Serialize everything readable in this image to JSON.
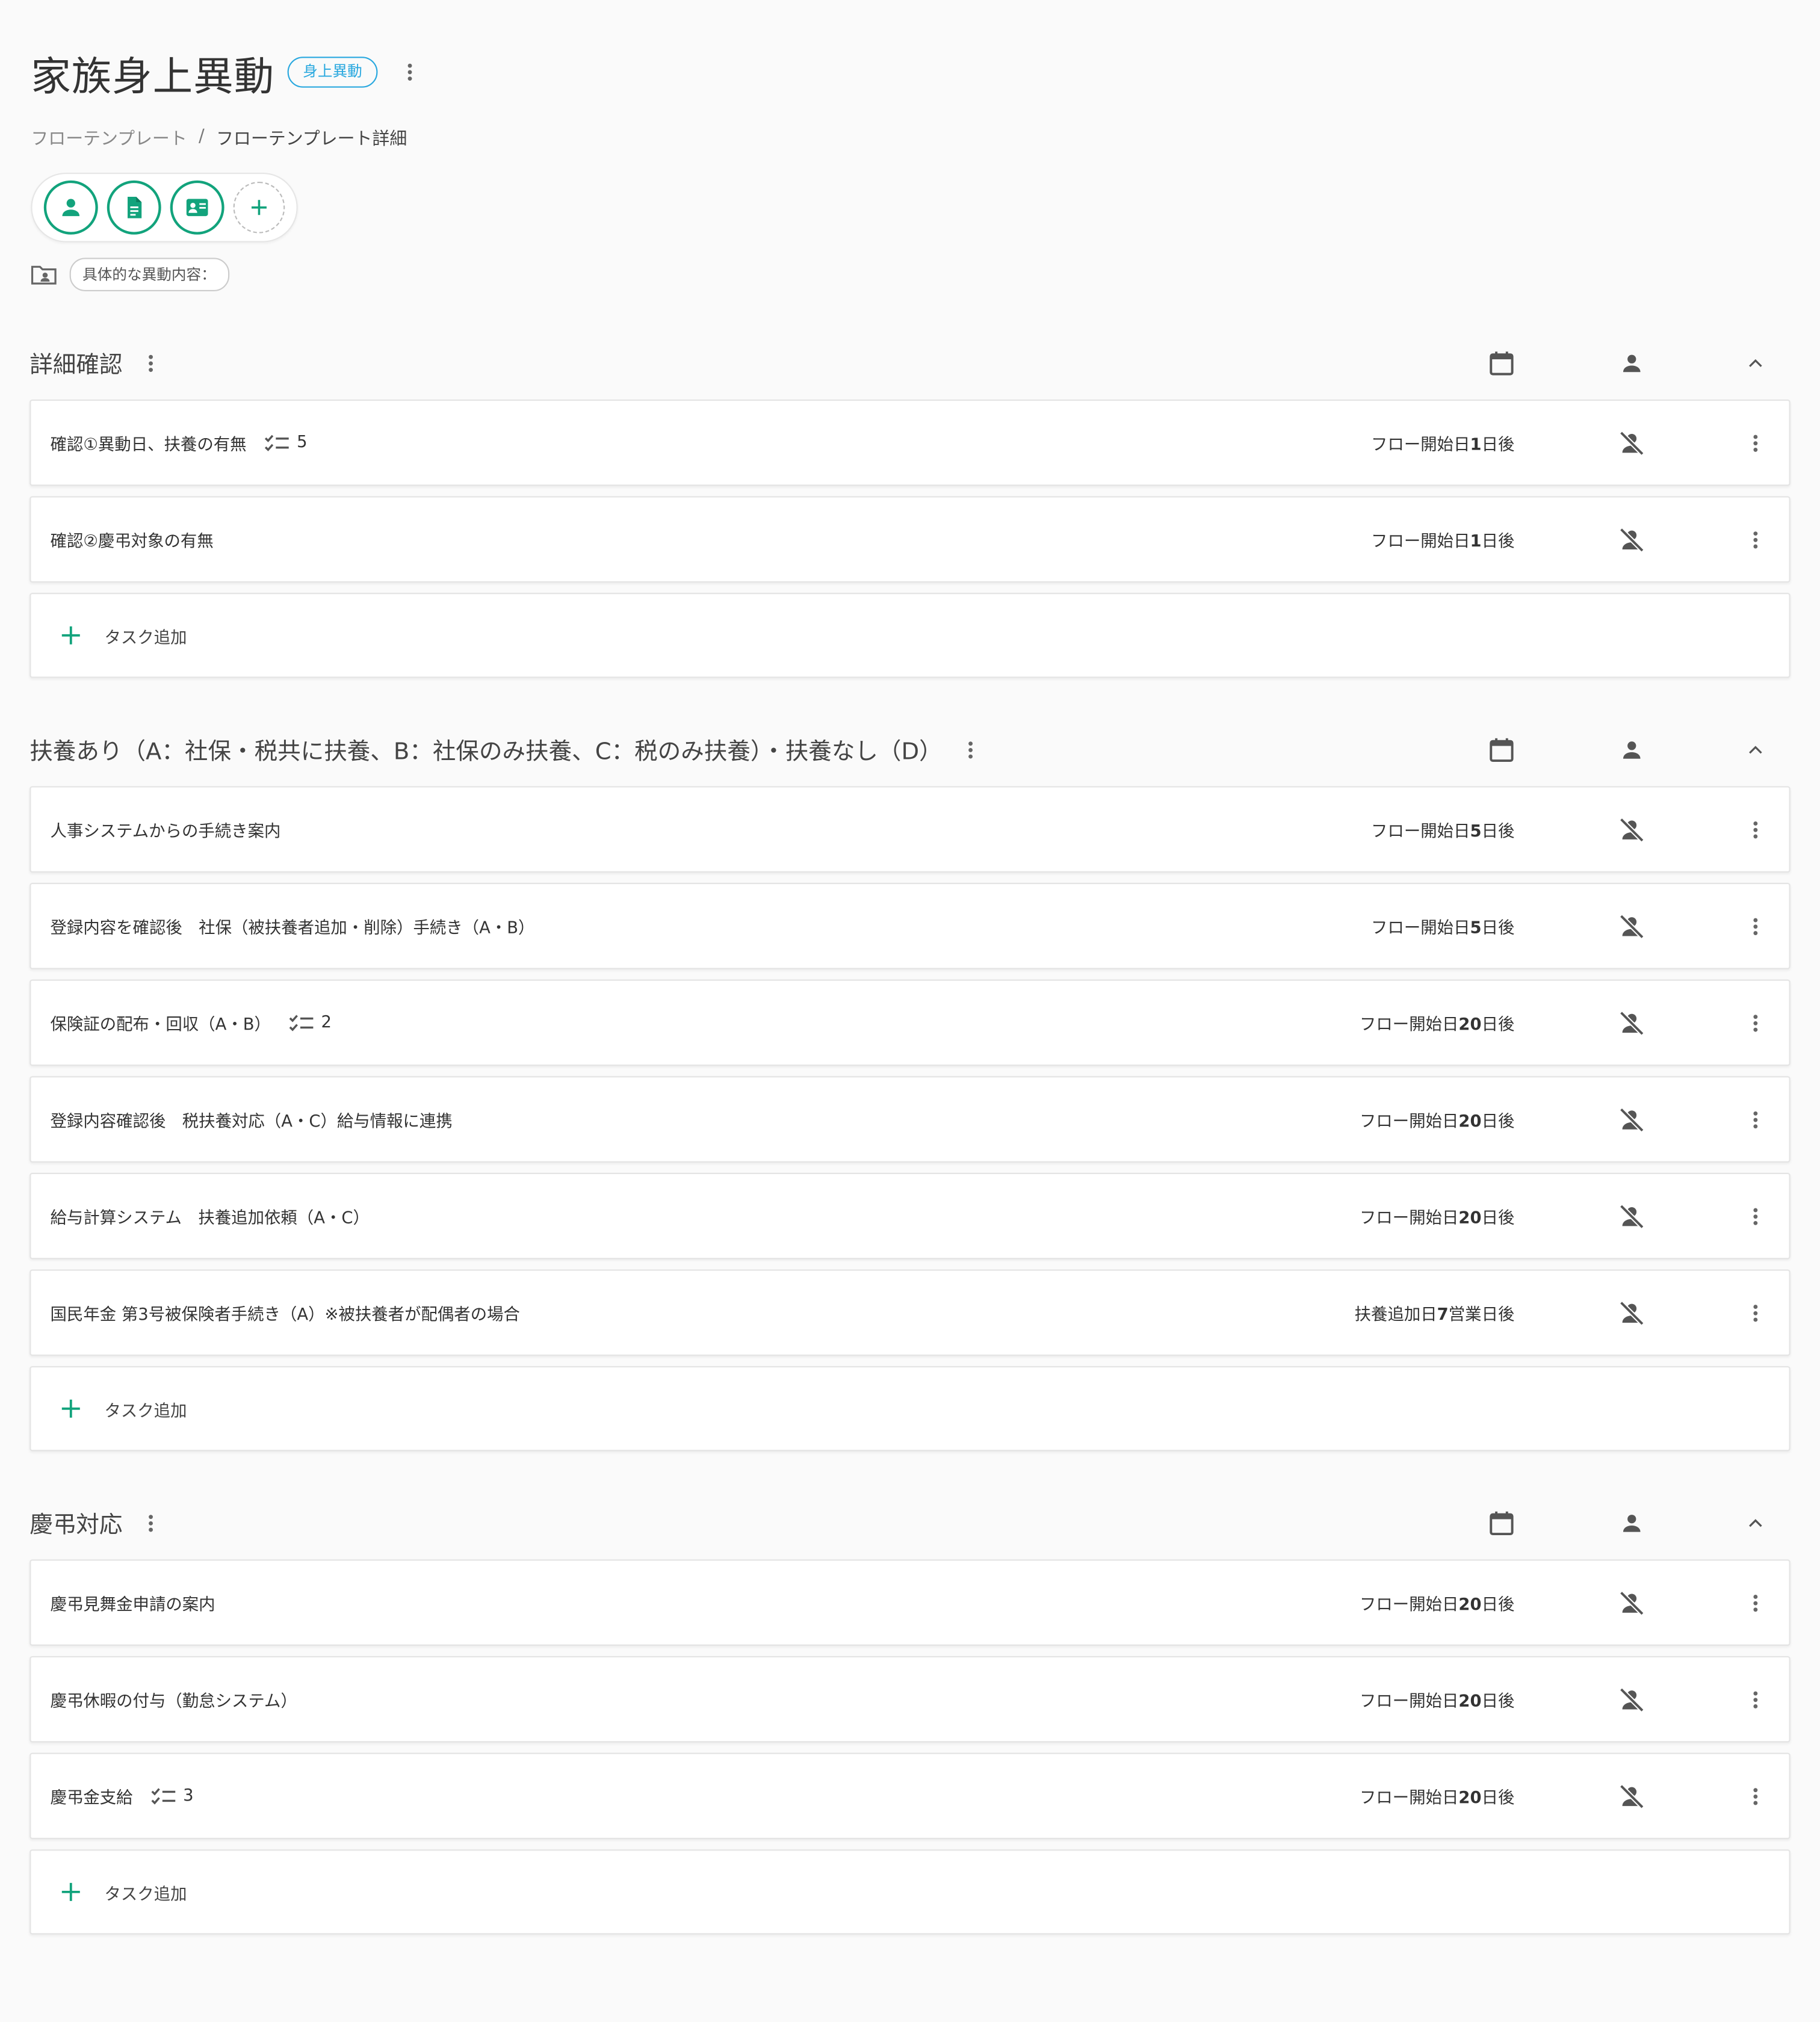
{
  "page": {
    "title": "家族身上異動",
    "badge": "身上異動",
    "breadcrumb": [
      "フローテンプレート",
      "フローテンプレート詳細"
    ],
    "breadcrumb_sep": "/",
    "tag_label": "具体的な異動内容："
  },
  "add_task_label": "タスク追加",
  "accent_color": "#12a37c",
  "badge_color": "#29a8df",
  "sections": [
    {
      "title": "詳細確認",
      "tasks": [
        {
          "name": "確認①異動日、扶養の有無",
          "checklist": "5",
          "due_prefix": "フロー開始日",
          "due_num": "1",
          "due_suffix": "日後"
        },
        {
          "name": "確認②慶弔対象の有無",
          "checklist": "",
          "due_prefix": "フロー開始日",
          "due_num": "1",
          "due_suffix": "日後"
        }
      ]
    },
    {
      "title": "扶養あり（A：社保・税共に扶養、B：社保のみ扶養、C：税のみ扶養）・扶養なし（D）",
      "tasks": [
        {
          "name": "人事システムからの手続き案内",
          "checklist": "",
          "due_prefix": "フロー開始日",
          "due_num": "5",
          "due_suffix": "日後"
        },
        {
          "name": "登録内容を確認後　社保（被扶養者追加・削除）手続き（A・B）",
          "checklist": "",
          "due_prefix": "フロー開始日",
          "due_num": "5",
          "due_suffix": "日後"
        },
        {
          "name": "保険証の配布・回収（A・B）",
          "checklist": "2",
          "due_prefix": "フロー開始日",
          "due_num": "20",
          "due_suffix": "日後"
        },
        {
          "name": "登録内容確認後　税扶養対応（A・C）給与情報に連携",
          "checklist": "",
          "due_prefix": "フロー開始日",
          "due_num": "20",
          "due_suffix": "日後"
        },
        {
          "name": "給与計算システム　扶養追加依頼（A・C）",
          "checklist": "",
          "due_prefix": "フロー開始日",
          "due_num": "20",
          "due_suffix": "日後"
        },
        {
          "name": "国民年金 第3号被保険者手続き（A）※被扶養者が配偶者の場合",
          "checklist": "",
          "due_prefix": "扶養追加日",
          "due_num": "7",
          "due_suffix": "営業日後"
        }
      ]
    },
    {
      "title": "慶弔対応",
      "tasks": [
        {
          "name": "慶弔見舞金申請の案内",
          "checklist": "",
          "due_prefix": "フロー開始日",
          "due_num": "20",
          "due_suffix": "日後"
        },
        {
          "name": "慶弔休暇の付与（勤怠システム）",
          "checklist": "",
          "due_prefix": "フロー開始日",
          "due_num": "20",
          "due_suffix": "日後"
        },
        {
          "name": "慶弔金支給",
          "checklist": "3",
          "due_prefix": "フロー開始日",
          "due_num": "20",
          "due_suffix": "日後"
        }
      ]
    }
  ]
}
